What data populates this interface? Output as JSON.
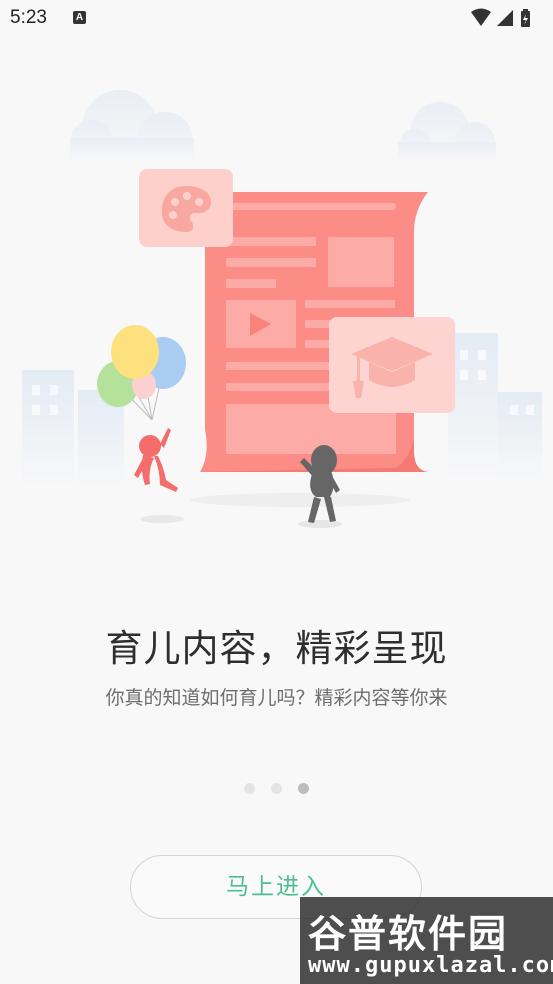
{
  "status_bar": {
    "time": "5:23",
    "notification_icon": "A"
  },
  "onboarding": {
    "headline": "育儿内容，精彩呈现",
    "subtitle": "你真的知道如何育儿吗？精彩内容等你来",
    "page_indicator": {
      "total": 3,
      "current": 3
    },
    "enter_button_label": "马上进入"
  },
  "watermark": {
    "title": "谷普软件园",
    "url": "www.gupuxlazal.com"
  },
  "colors": {
    "accent_green": "#4dbf8f",
    "document_salmon": "#fb8d86",
    "background": "#f8f8f8"
  },
  "icons": [
    "wifi-icon",
    "signal-icon",
    "battery-icon",
    "palette-icon",
    "graduation-cap-icon",
    "play-icon",
    "balloons-icon"
  ]
}
